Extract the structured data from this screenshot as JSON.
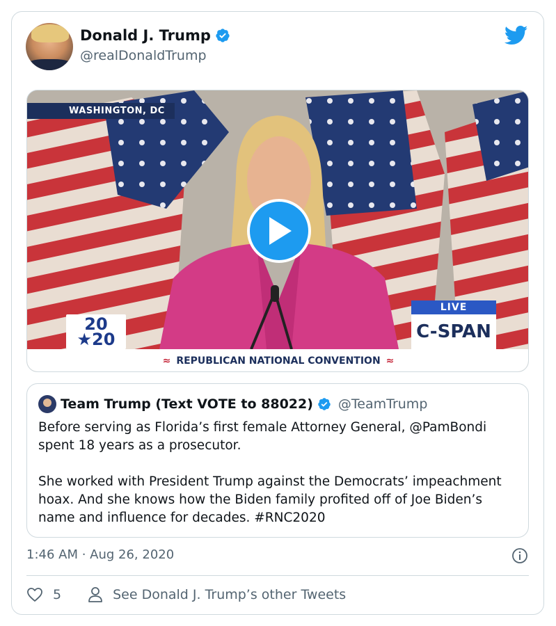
{
  "author": {
    "display_name": "Donald J. Trump",
    "handle": "@realDonaldTrump"
  },
  "media": {
    "location": "WASHINGTON, DC",
    "badge_2020": "20≈\n★20",
    "badge_top": "20",
    "badge_bottom": "★20",
    "live_label": "LIVE",
    "network": "C-SPAN",
    "banner": "REPUBLICAN NATIONAL CONVENTION"
  },
  "quoted_tweet": {
    "display_name": "Team Trump (Text VOTE to 88022)",
    "handle": "@TeamTrump",
    "paragraph_1": "Before serving as Florida’s first female Attorney General, @PamBondi spent 18 years as a prosecutor.",
    "paragraph_2": "She worked with President Trump against the Democrats’ impeachment hoax. And she knows how the Biden family profited off of Joe Biden’s name and influence for decades. #RNC2020"
  },
  "meta": {
    "timestamp": "1:46 AM · Aug 26, 2020"
  },
  "actions": {
    "like_count": "5",
    "see_other_label": "See Donald J. Trump’s other Tweets"
  },
  "colors": {
    "twitter_blue": "#1d9bf0",
    "muted_text": "#536471",
    "border": "#cfd9de"
  },
  "icons": [
    "verified-icon",
    "twitter-bird-icon",
    "play-icon",
    "info-icon",
    "heart-icon",
    "person-icon"
  ]
}
